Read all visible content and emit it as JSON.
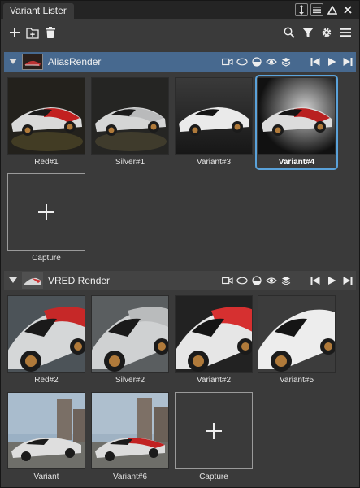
{
  "window": {
    "tab_title": "Variant Lister"
  },
  "sections": [
    {
      "name": "AliasRender",
      "variants": [
        {
          "label": "Red#1",
          "bg": "#1e1d18",
          "car": "#c22020"
        },
        {
          "label": "Silver#1",
          "bg": "#202020",
          "car": "#cfd0d0"
        },
        {
          "label": "Variant#3",
          "bg": "#2a2a2a",
          "car": "#e2e2e2"
        },
        {
          "label": "Variant#4",
          "bg": "#111111",
          "car": "#b92020",
          "selected": true
        }
      ],
      "capture_label": "Capture"
    },
    {
      "name": "VRED Render",
      "variants": [
        {
          "label": "Red#2",
          "bg": "#4c5358",
          "car": "#c62828"
        },
        {
          "label": "Silver#2",
          "bg": "#5a5e60",
          "car": "#c8cacb"
        },
        {
          "label": "Variant#2",
          "bg": "#222222",
          "car": "#d63030"
        },
        {
          "label": "Variant#5",
          "bg": "#3c3c3c",
          "car": "#e8e8e8"
        },
        {
          "label": "Variant",
          "bg": "#8ea2b8",
          "car": "#d8d8d8"
        },
        {
          "label": "Variant#6",
          "bg": "#8fa0b0",
          "car": "#c22222"
        }
      ],
      "capture_label": "Capture"
    }
  ],
  "colors": {
    "accent": "#47698f",
    "selection": "#5aa2da",
    "panel": "#3a3a3a"
  }
}
